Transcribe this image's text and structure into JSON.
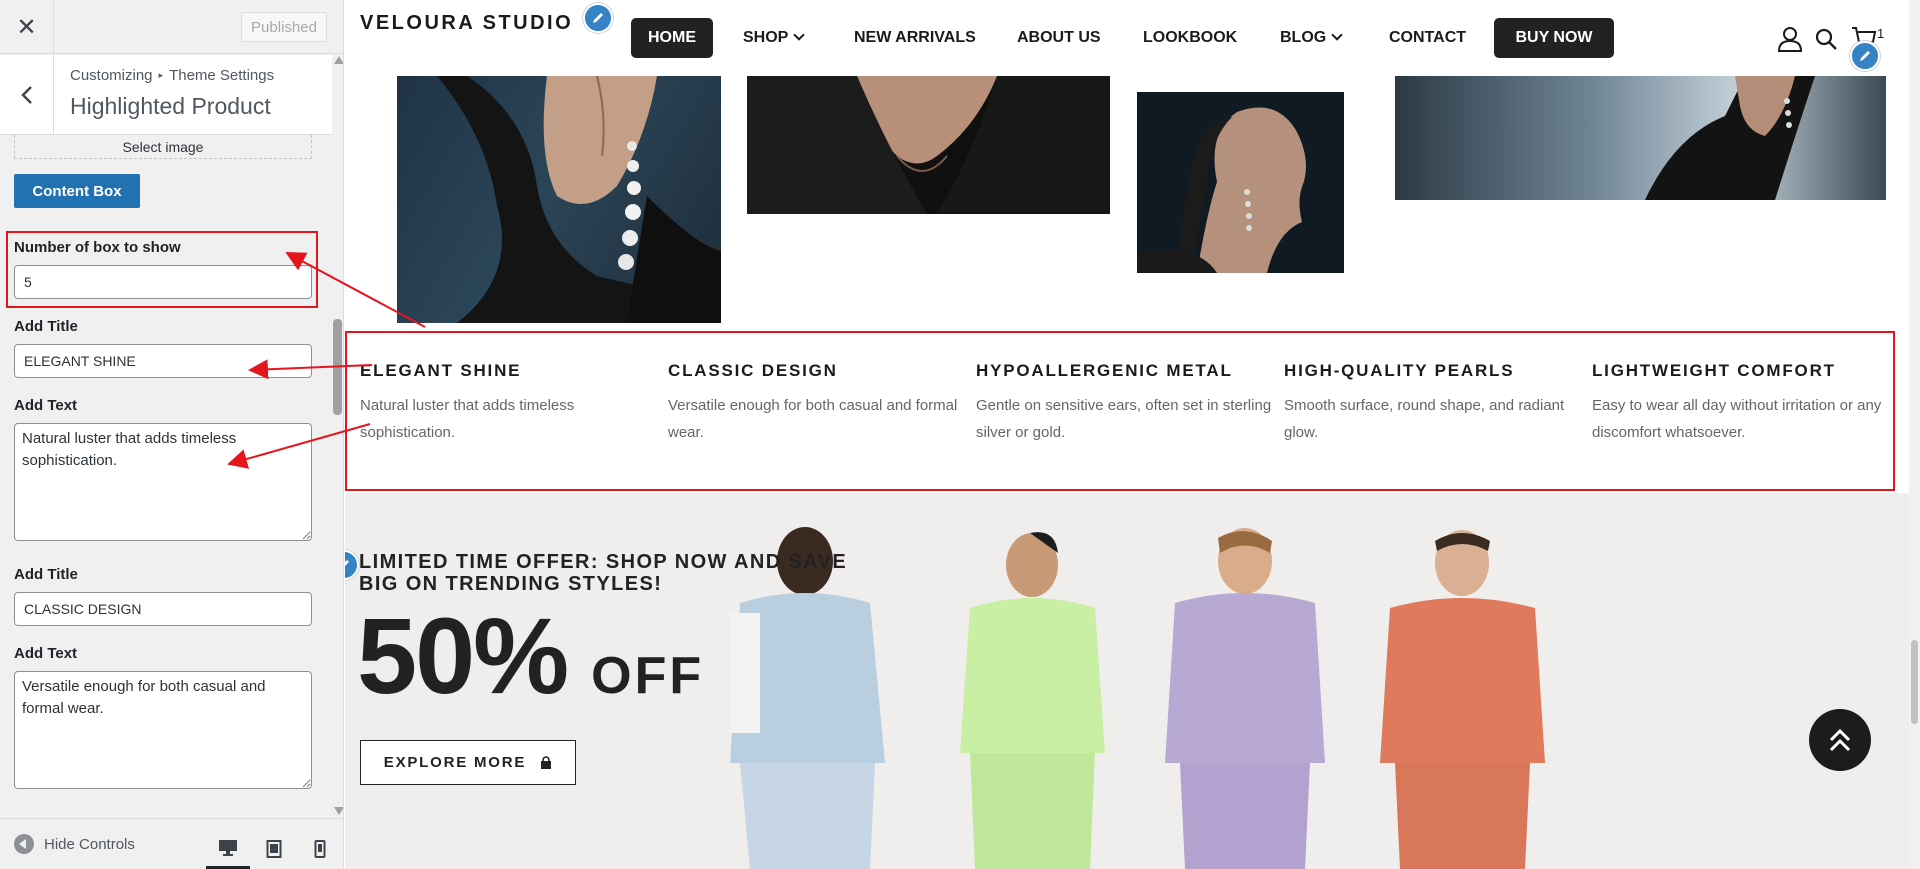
{
  "sidebar": {
    "published_label": "Published",
    "breadcrumb": [
      "Customizing",
      "Theme Settings"
    ],
    "section_title": "Highlighted Product",
    "select_image_label": "Select image",
    "content_box_label": "Content Box",
    "fields": {
      "box_count_label": "Number of box to show",
      "box_count_value": "5",
      "title1_label": "Add Title",
      "title1_value": "ELEGANT SHINE",
      "text1_label": "Add Text",
      "text1_value": "Natural luster that adds timeless sophistication.",
      "title2_label": "Add Title",
      "title2_value": "CLASSIC DESIGN",
      "text2_label": "Add Text",
      "text2_value": "Versatile enough for both casual and formal wear."
    },
    "hide_controls_label": "Hide Controls"
  },
  "preview": {
    "logo": "VELOURA STUDIO",
    "menu": {
      "home": "HOME",
      "shop": "SHOP",
      "new_arrivals": "NEW ARRIVALS",
      "about": "ABOUT US",
      "lookbook": "LOOKBOOK",
      "blog": "BLOG",
      "contact": "CONTACT",
      "buy_now": "BUY NOW"
    },
    "cart_count": "1",
    "features": [
      {
        "title": "ELEGANT SHINE",
        "text": "Natural luster that adds timeless sophistication."
      },
      {
        "title": "CLASSIC DESIGN",
        "text": "Versatile enough for both casual and formal wear."
      },
      {
        "title": "HYPOALLERGENIC METAL",
        "text": "Gentle on sensitive ears, often set in sterling silver or gold."
      },
      {
        "title": "HIGH-QUALITY PEARLS",
        "text": "Smooth surface, round shape, and radiant glow."
      },
      {
        "title": "LIGHTWEIGHT COMFORT",
        "text": "Easy to wear all day without irritation or any discomfort whatsoever."
      }
    ],
    "banner": {
      "offer": "LIMITED TIME OFFER: SHOP NOW AND SAVE BIG ON TRENDING STYLES!",
      "percent": "50%",
      "off": "OFF",
      "cta": "EXPLORE MORE"
    }
  },
  "icons": {
    "close": "close-icon",
    "back": "chevron-left-icon",
    "edit": "pencil-icon",
    "user": "user-icon",
    "search": "search-icon",
    "cart": "cart-icon",
    "bag": "shopping-bag-icon",
    "scroll_top": "double-chevron-up-icon",
    "desktop": "desktop-icon",
    "tablet": "tablet-icon",
    "mobile": "mobile-icon"
  },
  "colors": {
    "accent_blue": "#2271b1",
    "highlight_red": "#e3161e",
    "dark_button": "#222222",
    "banner_bg": "#efeeec"
  }
}
